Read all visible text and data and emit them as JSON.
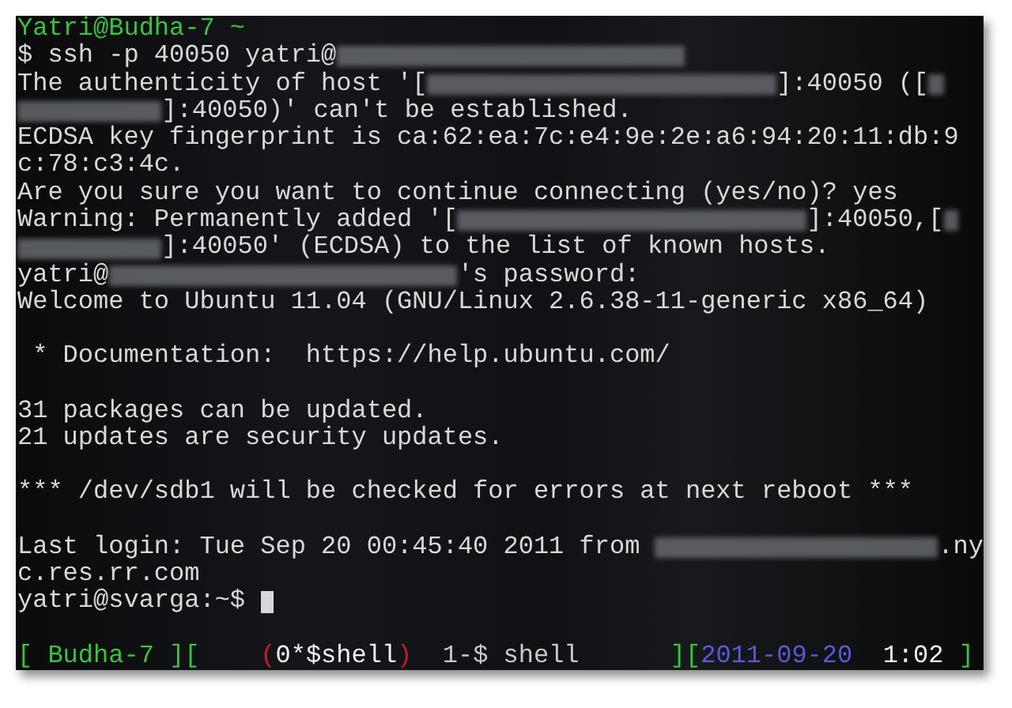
{
  "terminal": {
    "lines": [
      {
        "kind": "text",
        "segments": [
          {
            "kind": "text",
            "text": "Yatri@Budha-7 ~",
            "color": "#3cc23c"
          }
        ]
      },
      {
        "kind": "text",
        "segments": [
          {
            "kind": "text",
            "text": "$ ssh -p 40050 yatri@"
          },
          {
            "kind": "redacted"
          }
        ]
      },
      {
        "kind": "text",
        "segments": [
          {
            "kind": "text",
            "text": "The authenticity of host '["
          },
          {
            "kind": "redacted"
          },
          {
            "kind": "text",
            "text": "]:40050 (["
          },
          {
            "kind": "redacted"
          }
        ]
      },
      {
        "kind": "text",
        "segments": [
          {
            "kind": "redacted"
          },
          {
            "kind": "text",
            "text": "]:40050)' can't be established."
          }
        ]
      },
      {
        "kind": "text",
        "segments": [
          {
            "kind": "text",
            "text": "ECDSA key fingerprint is ca:62:ea:7c:e4:9e:2e:a6:94:20:11:db:9"
          }
        ]
      },
      {
        "kind": "text",
        "segments": [
          {
            "kind": "text",
            "text": "c:78:c3:4c."
          }
        ]
      },
      {
        "kind": "text",
        "segments": [
          {
            "kind": "text",
            "text": "Are you sure you want to continue connecting (yes/no)? yes"
          }
        ]
      },
      {
        "kind": "text",
        "segments": [
          {
            "kind": "text",
            "text": "Warning: Permanently added '["
          },
          {
            "kind": "redacted"
          },
          {
            "kind": "text",
            "text": "]:40050,["
          },
          {
            "kind": "redacted"
          }
        ]
      },
      {
        "kind": "text",
        "segments": [
          {
            "kind": "redacted"
          },
          {
            "kind": "text",
            "text": "]:40050' (ECDSA) to the list of known hosts."
          }
        ]
      },
      {
        "kind": "text",
        "segments": [
          {
            "kind": "text",
            "text": "yatri@"
          },
          {
            "kind": "redacted"
          },
          {
            "kind": "text",
            "text": "'s password:"
          }
        ]
      },
      {
        "kind": "text",
        "segments": [
          {
            "kind": "text",
            "text": "Welcome to Ubuntu 11.04 (GNU/Linux 2.6.38-11-generic x86_64)"
          }
        ]
      },
      {
        "kind": "blank"
      },
      {
        "kind": "text",
        "segments": [
          {
            "kind": "text",
            "text": " * Documentation:  https://help.ubuntu.com/"
          }
        ]
      },
      {
        "kind": "blank"
      },
      {
        "kind": "text",
        "segments": [
          {
            "kind": "text",
            "text": "31 packages can be updated."
          }
        ]
      },
      {
        "kind": "text",
        "segments": [
          {
            "kind": "text",
            "text": "21 updates are security updates."
          }
        ]
      },
      {
        "kind": "blank"
      },
      {
        "kind": "text",
        "segments": [
          {
            "kind": "text",
            "text": "*** /dev/sdb1 will be checked for errors at next reboot ***"
          }
        ]
      },
      {
        "kind": "blank"
      },
      {
        "kind": "text",
        "segments": [
          {
            "kind": "text",
            "text": "Last login: Tue Sep 20 00:45:40 2011 from "
          },
          {
            "kind": "redacted"
          },
          {
            "kind": "text",
            "text": ".ny"
          }
        ]
      },
      {
        "kind": "text",
        "segments": [
          {
            "kind": "text",
            "text": "c.res.rr.com"
          }
        ]
      },
      {
        "kind": "text",
        "segments": [
          {
            "kind": "text",
            "text": "yatri@svarga:~$ "
          },
          {
            "kind": "cursor"
          }
        ]
      },
      {
        "kind": "blank"
      }
    ],
    "status_bar": [
      {
        "text": "[ Budha-7 ][    ",
        "color": "#3cc23c"
      },
      {
        "text": "(",
        "color": "#c02020"
      },
      {
        "text": "0*$shell",
        "color": "#f0f0f0"
      },
      {
        "text": ")",
        "color": "#c02020"
      },
      {
        "text": "  1-$ shell      ",
        "color": "#c8c8c8"
      },
      {
        "text": "][",
        "color": "#3cc23c"
      },
      {
        "text": "2011-09-20",
        "color": "#5a5ad8"
      },
      {
        "text": "  1:02 ",
        "color": "#f0f0f0"
      },
      {
        "text": "]",
        "color": "#3cc23c"
      }
    ]
  }
}
